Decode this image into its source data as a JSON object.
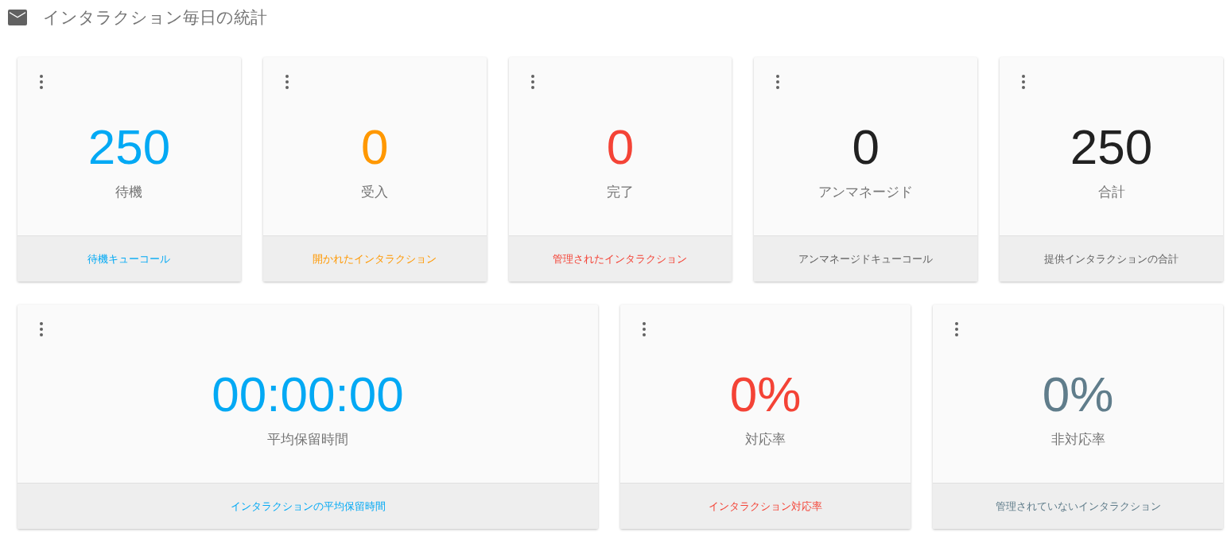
{
  "title": "インタラクション毎日の統計",
  "rows": [
    {
      "cards": [
        {
          "value": "250",
          "label": "待機",
          "footer": "待機キューコール",
          "color": "#03a9f4"
        },
        {
          "value": "0",
          "label": "受入",
          "footer": "開かれたインタラクション",
          "color": "#ff9800"
        },
        {
          "value": "0",
          "label": "完了",
          "footer": "管理されたインタラクション",
          "color": "#f44336"
        },
        {
          "value": "0",
          "label": "アンマネージド",
          "footer": "アンマネージドキューコール",
          "color": "#212121"
        },
        {
          "value": "250",
          "label": "合計",
          "footer": "提供インタラクションの合計",
          "color": "#212121"
        }
      ]
    },
    {
      "cards": [
        {
          "value": "00:00:00",
          "label": "平均保留時間",
          "footer": "インタラクションの平均保留時間",
          "color": "#03a9f4"
        },
        {
          "value": "0%",
          "label": "対応率",
          "footer": "インタラクション対応率",
          "color": "#f44336"
        },
        {
          "value": "0%",
          "label": "非対応率",
          "footer": "管理されていないインタラクション",
          "color": "#607d8b"
        }
      ]
    }
  ]
}
